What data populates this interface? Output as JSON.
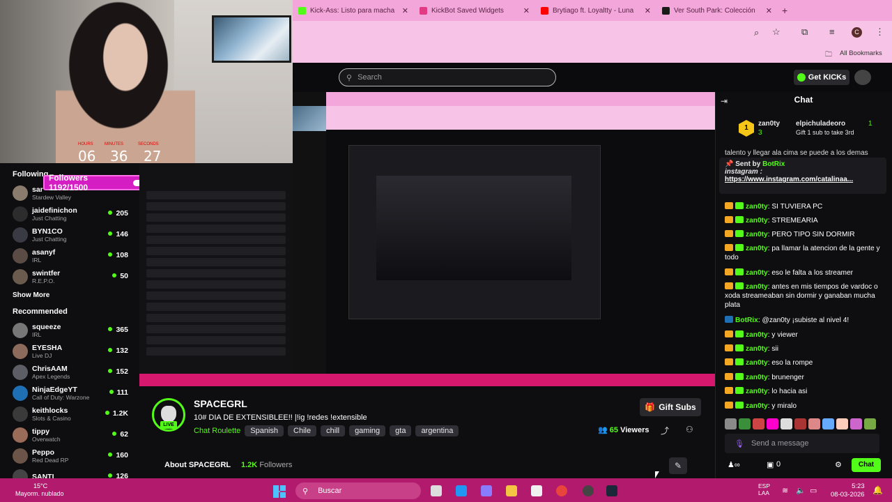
{
  "overlay": {
    "timer": {
      "hours_label": "HOURS",
      "minutes_label": "MINUTES",
      "seconds_label": "SECONDS",
      "hours": "06",
      "minutes": "36",
      "seconds": "27"
    },
    "followers_goal": "Followers 1192/1500"
  },
  "browser": {
    "tabs": [
      {
        "label": "Kick-Ass: Listo para macha",
        "icon_color": "#53fc18"
      },
      {
        "label": "KickBot Saved Widgets",
        "icon_color": "#e23a84"
      },
      {
        "label": "Brytiago ft. Loyaltty - Luna",
        "icon_color": "#ff0000"
      },
      {
        "label": "Ver South Park: Colección",
        "icon_color": "#1a1a1a"
      }
    ],
    "new_tab": "+",
    "bookmarks_label": "All Bookmarks",
    "profile_initial": "C"
  },
  "kick": {
    "search_placeholder": "Search",
    "get_kicks": "Get KICKs",
    "sidebar": {
      "following_title": "Following",
      "following": [
        {
          "name": "sar",
          "game": "Stardew Valley",
          "viewers": "",
          "color": "#8a7c6c"
        },
        {
          "name": "jaidefinichon",
          "game": "Just Chatting",
          "viewers": "205",
          "color": "#2c2c2c"
        },
        {
          "name": "BYN1CO",
          "game": "Just Chatting",
          "viewers": "146",
          "color": "#3a3a44"
        },
        {
          "name": "asanyf",
          "game": "IRL",
          "viewers": "108",
          "color": "#5b4b45"
        },
        {
          "name": "swintfer",
          "game": "R.E.P.O.",
          "viewers": "50",
          "color": "#6b5b4f"
        }
      ],
      "show_more": "Show More",
      "recommended_title": "Recommended",
      "recommended": [
        {
          "name": "squeeze",
          "game": "IRL",
          "viewers": "365",
          "color": "#777"
        },
        {
          "name": "EYESHA",
          "game": "Live DJ",
          "viewers": "132",
          "color": "#8c6a5c"
        },
        {
          "name": "ChrisAAM",
          "game": "Apex Legends",
          "viewers": "152",
          "color": "#5d5d66"
        },
        {
          "name": "NinjaEdgeYT",
          "game": "Call of Duty: Warzone",
          "viewers": "111",
          "color": "#1f6fb5"
        },
        {
          "name": "keithlocks",
          "game": "Slots & Casino",
          "viewers": "1.2K",
          "color": "#3a3a3a"
        },
        {
          "name": "tippy",
          "game": "Overwatch",
          "viewers": "62",
          "color": "#9b6b5a"
        },
        {
          "name": "Peppo",
          "game": "Red Dead RP",
          "viewers": "160",
          "color": "#6c5548"
        },
        {
          "name": "SANTI",
          "game": "",
          "viewers": "126",
          "color": "#444"
        }
      ]
    },
    "channel": {
      "name": "SPACEGRL",
      "live": "LIVE",
      "title": "10#  DIA DE EXTENSIBLEE!! |!ig !redes !extensible",
      "category": "Chat Roulette",
      "tags": [
        "Spanish",
        "Chile",
        "chill",
        "gaming",
        "gta",
        "argentina"
      ],
      "gift_subs": "Gift Subs",
      "viewers": "65",
      "viewers_label": "Viewers",
      "about": "About SPACEGRL",
      "followers_count": "1.2K",
      "followers_label": "Followers"
    },
    "chat": {
      "title": "Chat",
      "sub_gift": {
        "user": "zan0ty",
        "count": "3",
        "target": "elpichuladeoro",
        "count2": "1",
        "text": "Gift 1 sub to take 3rd"
      },
      "scroll_text": "talento y llegar ala cima se puede a los demas",
      "pinned": {
        "by_label": "Sent by",
        "by_user": "BotRix",
        "line1": "instagram :",
        "link": "https://www.instagram.com/catalinaa..."
      },
      "messages": [
        {
          "user": "zan0ty",
          "text": "SI TUVIERA PC"
        },
        {
          "user": "zan0ty",
          "text": "STREMEARIA"
        },
        {
          "user": "zan0ty",
          "text": "PERO TIPO SIN DORMIR"
        },
        {
          "user": "zan0ty",
          "text": "pa llamar la atencion de la gente y todo"
        },
        {
          "user": "zan0ty",
          "text": "eso le falta a los streamer"
        },
        {
          "user": "zan0ty",
          "text": "antes en mis tiempos de vardoc o xoda streameaban sin dormir y ganaban mucha plata"
        },
        {
          "user": "BotRix",
          "text": "@zan0ty ¡subiste al nivel 4!",
          "bot": true
        },
        {
          "user": "zan0ty",
          "text": "y viewer"
        },
        {
          "user": "zan0ty",
          "text": "sii"
        },
        {
          "user": "zan0ty",
          "text": "eso la rompe"
        },
        {
          "user": "zan0ty",
          "text": "brunenger"
        },
        {
          "user": "zan0ty",
          "text": "lo hacia asi"
        },
        {
          "user": "zan0ty",
          "text": "y miralo"
        }
      ],
      "input_placeholder": "Send a message",
      "points": "0",
      "chat_button": "Chat"
    }
  },
  "taskbar": {
    "temp": "15°C",
    "weather": "Mayorm. nublado",
    "search": "Buscar",
    "lang1": "ESP",
    "lang2": "LAA",
    "time": "5:23",
    "date": "08-03-2026"
  }
}
